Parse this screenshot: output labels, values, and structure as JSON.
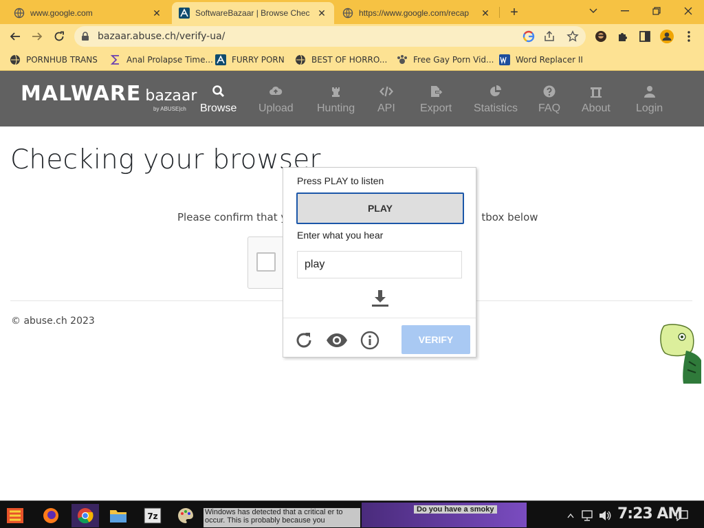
{
  "browser": {
    "tabs": [
      {
        "title": "www.google.com",
        "active": false
      },
      {
        "title": "SoftwareBazaar | Browse Chec",
        "active": true
      },
      {
        "title": "https://www.google.com/recap",
        "active": false
      }
    ],
    "address": "bazaar.abuse.ch/verify-ua/",
    "bookmarks": [
      "PORNHUB TRANS",
      "Anal Prolapse Time...",
      "FURRY PORN",
      "BEST OF HORRO...",
      "Free Gay Porn Vid...",
      "Word Replacer II"
    ],
    "colors": {
      "tabstrip": "#f6c243",
      "toolbar": "#fde293"
    }
  },
  "site": {
    "logo_main": "MALWARE",
    "logo_sub": "bazaar",
    "logo_by": "by ABUSE|ch",
    "nav": [
      {
        "label": "Browse",
        "icon": "search-icon",
        "active": true
      },
      {
        "label": "Upload",
        "icon": "cloud-upload-icon",
        "active": false
      },
      {
        "label": "Hunting",
        "icon": "chess-rook-icon",
        "active": false
      },
      {
        "label": "API",
        "icon": "code-icon",
        "active": false
      },
      {
        "label": "Export",
        "icon": "file-export-icon",
        "active": false
      },
      {
        "label": "Statistics",
        "icon": "pie-chart-icon",
        "active": false
      },
      {
        "label": "FAQ",
        "icon": "question-icon",
        "active": false
      },
      {
        "label": "About",
        "icon": "building-icon",
        "active": false
      },
      {
        "label": "Login",
        "icon": "user-icon",
        "active": false
      }
    ],
    "header_color": "#616161"
  },
  "main": {
    "title": "Checking your browser",
    "confirm_left": "Please confirm that yo",
    "confirm_right": "tbox below",
    "copyright": "© abuse.ch 2023"
  },
  "captcha": {
    "instruction": "Press PLAY to listen",
    "play_label": "PLAY",
    "answer_label": "Enter what you hear",
    "answer_value": "play",
    "verify_label": "VERIFY",
    "verify_color": "#a9c9f3"
  },
  "taskbar": {
    "ghost_text_1": "Windows has detected that a critical er to occur. This is probably because you",
    "ghost_text_2": "Do you have a smoky",
    "clock": "7:23 AM"
  }
}
